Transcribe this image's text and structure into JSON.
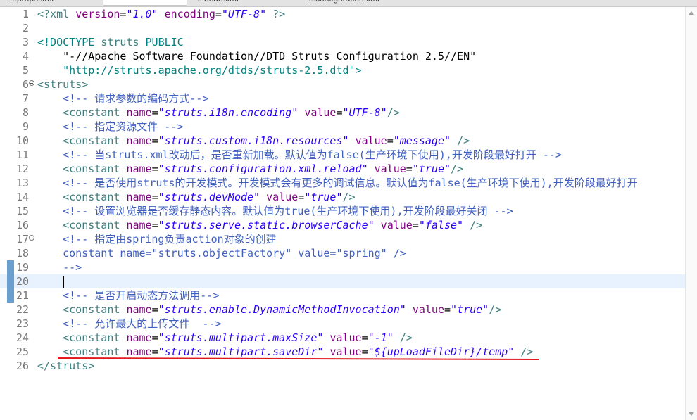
{
  "tabs": [
    {
      "label": "...props.xml"
    },
    {
      "label": ""
    },
    {
      "label": "...bean.xml"
    },
    {
      "label": "...configuration.xml"
    }
  ],
  "editor": {
    "current_line": 20,
    "lines": [
      {
        "n": "1",
        "parts": [
          [
            "pi",
            "<?xml "
          ],
          [
            "attr",
            "version"
          ],
          [
            "plain",
            "="
          ],
          [
            "val",
            "\"1.0\""
          ],
          [
            "plain",
            " "
          ],
          [
            "attr",
            "encoding"
          ],
          [
            "plain",
            "="
          ],
          [
            "val",
            "\"UTF-8\""
          ],
          [
            "pi",
            " ?>"
          ]
        ]
      },
      {
        "n": "2",
        "parts": []
      },
      {
        "n": "3",
        "parts": [
          [
            "dt",
            "<!DOCTYPE "
          ],
          [
            "tag",
            "struts"
          ],
          [
            "dt",
            " PUBLIC"
          ]
        ]
      },
      {
        "n": "4",
        "parts": [
          [
            "plain",
            "    "
          ],
          [
            "plain",
            "\"-//Apache Software Foundation//DTD Struts Configuration 2.5//EN\""
          ]
        ]
      },
      {
        "n": "5",
        "parts": [
          [
            "plain",
            "    "
          ],
          [
            "dt",
            "\"http://struts.apache.org/dtds/struts-2.5.dtd\""
          ],
          [
            "dt",
            ">"
          ]
        ]
      },
      {
        "n": "6",
        "fold": true,
        "parts": [
          [
            "tag",
            "<struts>"
          ]
        ]
      },
      {
        "n": "7",
        "parts": [
          [
            "plain",
            "    "
          ],
          [
            "cm",
            "<!-- 请求参数的编码方式-->"
          ]
        ]
      },
      {
        "n": "8",
        "parts": [
          [
            "plain",
            "    "
          ],
          [
            "tag",
            "<constant "
          ],
          [
            "attr",
            "name"
          ],
          [
            "plain",
            "="
          ],
          [
            "val",
            "\"struts.i18n.encoding\""
          ],
          [
            "plain",
            " "
          ],
          [
            "attr",
            "value"
          ],
          [
            "plain",
            "="
          ],
          [
            "val",
            "\"UTF-8\""
          ],
          [
            "tag",
            "/>"
          ]
        ]
      },
      {
        "n": "9",
        "parts": [
          [
            "plain",
            "    "
          ],
          [
            "cm",
            "<!-- 指定资源文件 -->"
          ]
        ]
      },
      {
        "n": "10",
        "parts": [
          [
            "plain",
            "    "
          ],
          [
            "tag",
            "<constant "
          ],
          [
            "attr",
            "name"
          ],
          [
            "plain",
            "="
          ],
          [
            "val",
            "\"struts.custom.i18n.resources\""
          ],
          [
            "plain",
            " "
          ],
          [
            "attr",
            "value"
          ],
          [
            "plain",
            "="
          ],
          [
            "val",
            "\"message\""
          ],
          [
            "tag",
            " />"
          ]
        ]
      },
      {
        "n": "11",
        "parts": [
          [
            "plain",
            "    "
          ],
          [
            "cm",
            "<!-- 当struts.xml改动后，是否重新加载。默认值为false(生产环境下使用),开发阶段最好打开 -->"
          ]
        ]
      },
      {
        "n": "12",
        "parts": [
          [
            "plain",
            "    "
          ],
          [
            "tag",
            "<constant "
          ],
          [
            "attr",
            "name"
          ],
          [
            "plain",
            "="
          ],
          [
            "val",
            "\"struts.configuration.xml.reload\""
          ],
          [
            "plain",
            " "
          ],
          [
            "attr",
            "value"
          ],
          [
            "plain",
            "="
          ],
          [
            "val",
            "\"true\""
          ],
          [
            "tag",
            "/>"
          ]
        ]
      },
      {
        "n": "13",
        "parts": [
          [
            "plain",
            "    "
          ],
          [
            "cm",
            "<!-- 是否使用struts的开发模式。开发模式会有更多的调试信息。默认值为false(生产环境下使用),开发阶段最好打开"
          ]
        ]
      },
      {
        "n": "14",
        "parts": [
          [
            "plain",
            "    "
          ],
          [
            "tag",
            "<constant "
          ],
          [
            "attr",
            "name"
          ],
          [
            "plain",
            "="
          ],
          [
            "val",
            "\"struts.devMode\""
          ],
          [
            "plain",
            " "
          ],
          [
            "attr",
            "value"
          ],
          [
            "plain",
            "="
          ],
          [
            "val",
            "\"true\""
          ],
          [
            "tag",
            "/>"
          ]
        ]
      },
      {
        "n": "15",
        "parts": [
          [
            "plain",
            "    "
          ],
          [
            "cm",
            "<!-- 设置浏览器是否缓存静态内容。默认值为true(生产环境下使用),开发阶段最好关闭 -->"
          ]
        ]
      },
      {
        "n": "16",
        "parts": [
          [
            "plain",
            "    "
          ],
          [
            "tag",
            "<constant "
          ],
          [
            "attr",
            "name"
          ],
          [
            "plain",
            "="
          ],
          [
            "val",
            "\"struts.serve.static.browserCache\""
          ],
          [
            "plain",
            " "
          ],
          [
            "attr",
            "value"
          ],
          [
            "plain",
            "="
          ],
          [
            "val",
            "\"false\""
          ],
          [
            "tag",
            " />"
          ]
        ]
      },
      {
        "n": "17",
        "fold": true,
        "parts": [
          [
            "plain",
            "    "
          ],
          [
            "cm",
            "<!-- 指定由spring负责action对象的创建"
          ]
        ]
      },
      {
        "n": "18",
        "parts": [
          [
            "plain",
            "    "
          ],
          [
            "cm",
            "constant name=\"struts.objectFactory\" value=\"spring\" />"
          ]
        ]
      },
      {
        "n": "19",
        "changed": true,
        "parts": [
          [
            "plain",
            "    "
          ],
          [
            "cm",
            "-->"
          ]
        ]
      },
      {
        "n": "20",
        "changed": true,
        "parts": []
      },
      {
        "n": "21",
        "changed": true,
        "parts": [
          [
            "plain",
            "    "
          ],
          [
            "cm",
            "<!-- 是否开启动态方法调用-->"
          ]
        ]
      },
      {
        "n": "22",
        "parts": [
          [
            "plain",
            "    "
          ],
          [
            "tag",
            "<constant "
          ],
          [
            "attr",
            "name"
          ],
          [
            "plain",
            "="
          ],
          [
            "val",
            "\"struts.enable.DynamicMethodInvocation\""
          ],
          [
            "plain",
            " "
          ],
          [
            "attr",
            "value"
          ],
          [
            "plain",
            "="
          ],
          [
            "val",
            "\"true\""
          ],
          [
            "tag",
            "/>"
          ]
        ]
      },
      {
        "n": "23",
        "parts": [
          [
            "plain",
            "    "
          ],
          [
            "cm",
            "<!-- 允许最大的上传文件  -->"
          ]
        ]
      },
      {
        "n": "24",
        "parts": [
          [
            "plain",
            "    "
          ],
          [
            "tag",
            "<constant "
          ],
          [
            "attr",
            "name"
          ],
          [
            "plain",
            "="
          ],
          [
            "val",
            "\"struts.multipart.maxSize\""
          ],
          [
            "plain",
            " "
          ],
          [
            "attr",
            "value"
          ],
          [
            "plain",
            "="
          ],
          [
            "val",
            "\"-1\""
          ],
          [
            "tag",
            " />"
          ]
        ]
      },
      {
        "n": "25",
        "parts": [
          [
            "plain",
            "    "
          ],
          [
            "tag",
            "<constant "
          ],
          [
            "attr",
            "name"
          ],
          [
            "plain",
            "="
          ],
          [
            "val",
            "\"struts.multipart.saveDir\""
          ],
          [
            "plain",
            " "
          ],
          [
            "attr",
            "value"
          ],
          [
            "plain",
            "="
          ],
          [
            "val",
            "\"${upLoadFileDir}/temp\""
          ],
          [
            "tag",
            " />"
          ]
        ]
      },
      {
        "n": "26",
        "parts": [
          [
            "tag",
            "</struts>"
          ]
        ]
      }
    ]
  },
  "annotation": {
    "color": "#e0191e",
    "target_line": 25
  }
}
